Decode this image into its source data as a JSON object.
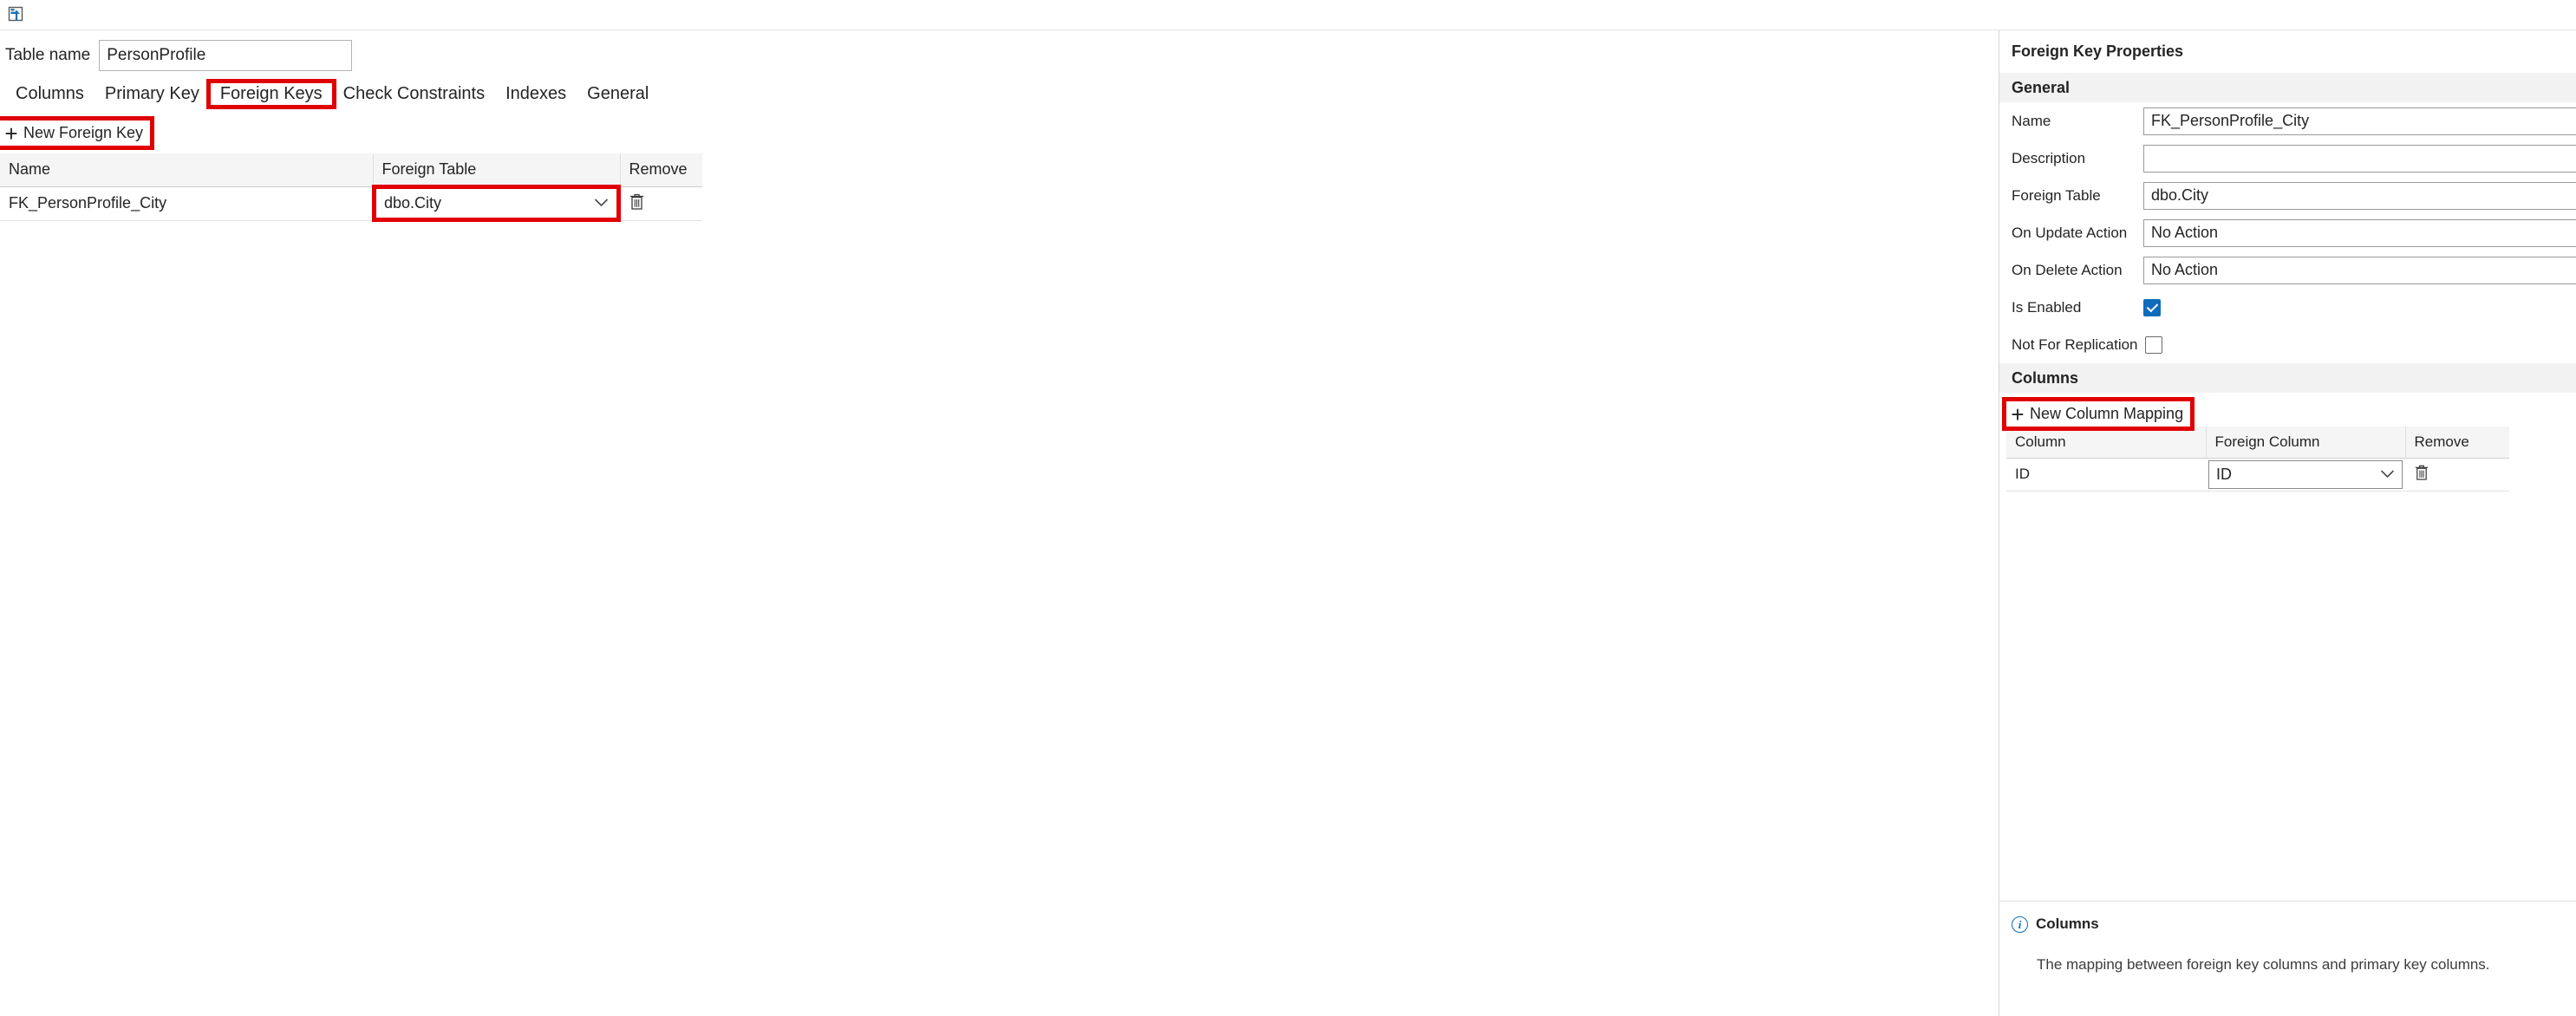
{
  "toolbar": {
    "publish_icon": "publish-changes-icon",
    "publish_tooltip": "Publish Changes"
  },
  "table": {
    "name_label": "Table name",
    "name_value": "PersonProfile",
    "name_placeholder": "Table name"
  },
  "tabs": [
    {
      "label": "Columns",
      "selected": false
    },
    {
      "label": "Primary Key",
      "selected": false
    },
    {
      "label": "Foreign Keys",
      "selected": true
    },
    {
      "label": "Check Constraints",
      "selected": false
    },
    {
      "label": "Indexes",
      "selected": false
    },
    {
      "label": "General",
      "selected": false
    }
  ],
  "foreign_keys_tab": {
    "new_button_label": "New Foreign Key",
    "plus_glyph": "+",
    "columns": [
      "Name",
      "Foreign Table",
      "Remove"
    ],
    "rows": [
      {
        "name": "FK_PersonProfile_City",
        "foreign_table": "dbo.City",
        "remove_icon": "trash-icon"
      }
    ]
  },
  "properties": {
    "title": "Foreign Key Properties",
    "general_section": "General",
    "fields": [
      {
        "label": "Name",
        "value": "FK_PersonProfile_City",
        "type": "text"
      },
      {
        "label": "Description",
        "value": "",
        "type": "text"
      },
      {
        "label": "Foreign Table",
        "value": "dbo.City",
        "type": "text"
      },
      {
        "label": "On Update Action",
        "value": "No Action",
        "type": "text"
      },
      {
        "label": "On Delete Action",
        "value": "No Action",
        "type": "text"
      }
    ],
    "checkboxes": [
      {
        "label": "Is Enabled",
        "checked": true
      },
      {
        "label": "Not For Replication",
        "checked": false
      }
    ],
    "columns_section": "Columns",
    "new_mapping_label": "New Column Mapping",
    "plus_glyph": "+",
    "mapping_columns": [
      "Column",
      "Foreign Column",
      "Remove"
    ],
    "mapping_rows": [
      {
        "column": "ID",
        "foreign_column": "ID",
        "remove_icon": "trash-icon"
      }
    ]
  },
  "info_panel": {
    "icon": "info-circle-icon",
    "title": "Columns",
    "description": "The mapping between foreign key columns and primary key columns."
  },
  "colors": {
    "annotation_red": "#e00000",
    "accent_blue": "#0f6cbd",
    "header_gray": "#f5f5f5",
    "section_gray": "#f2f2f2",
    "border_gray": "#d6d6d6"
  },
  "chevron_glyph": "⌄"
}
